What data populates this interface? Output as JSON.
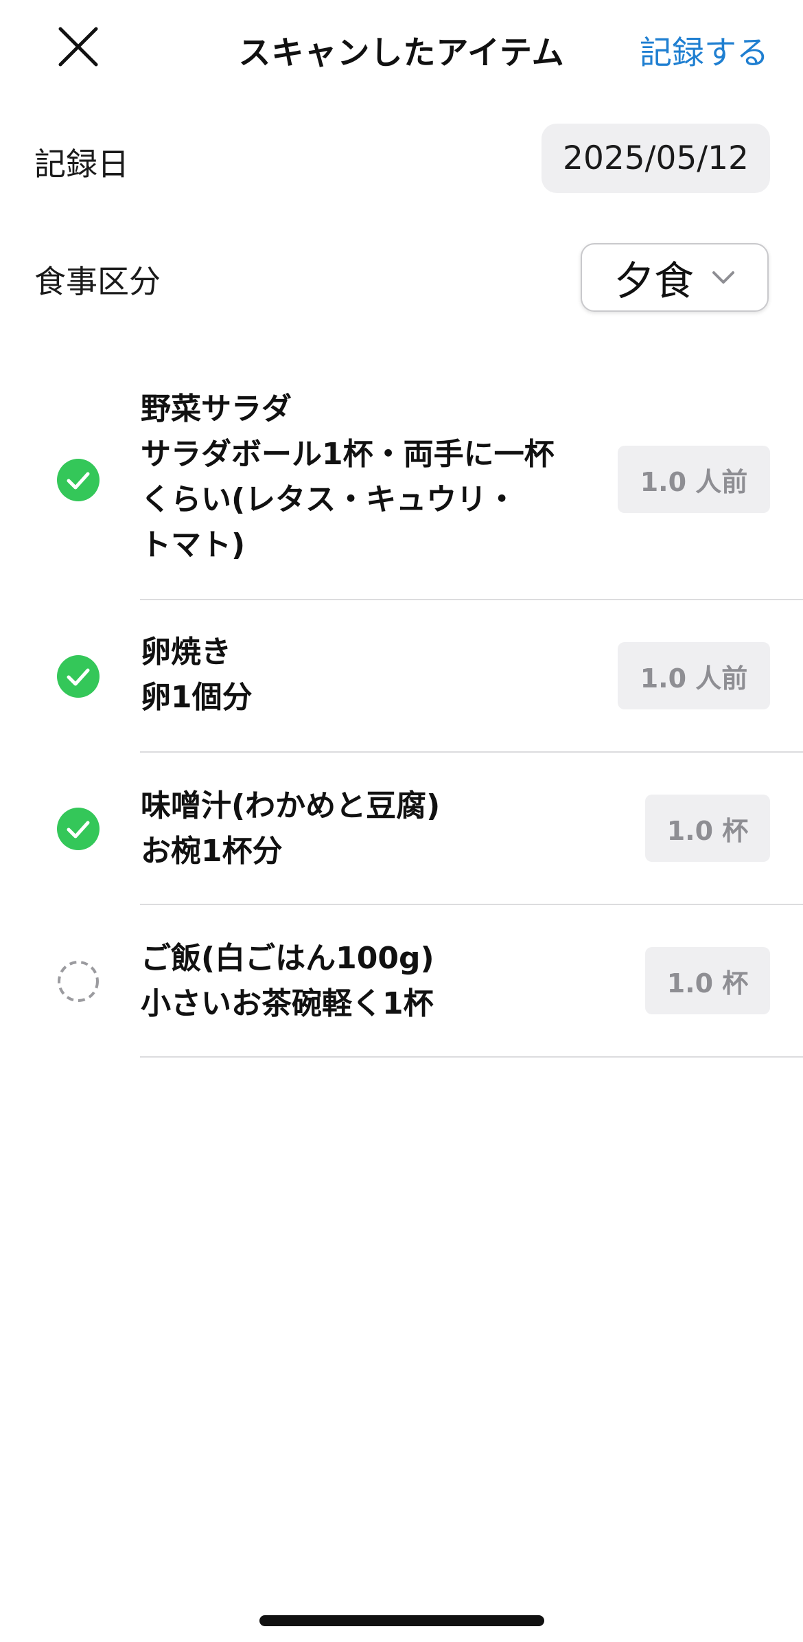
{
  "header": {
    "title": "スキャンしたアイテム",
    "record_label": "記録する",
    "close_icon": "close-icon"
  },
  "form": {
    "date_label": "記録日",
    "date_value": "2025/05/12",
    "meal_label": "食事区分",
    "meal_value": "夕食"
  },
  "items": [
    {
      "lines": [
        "野菜サラダ",
        "サラダボール1杯・両手に一杯",
        "くらい(レタス・キュウリ・",
        "トマト)"
      ],
      "quantity": "1.0 人前",
      "checked": true
    },
    {
      "lines": [
        "卵焼き",
        "卵1個分"
      ],
      "quantity": "1.0 人前",
      "checked": true
    },
    {
      "lines": [
        "味噌汁(わかめと豆腐)",
        "お椀1杯分"
      ],
      "quantity": "1.0 杯",
      "checked": true
    },
    {
      "lines": [
        "ご飯(白ごはん100g)",
        "小さいお茶碗軽く1杯"
      ],
      "quantity": "1.0 杯",
      "checked": false
    }
  ],
  "colors": {
    "accent": "#1f7fd1",
    "check_green": "#34c759",
    "unchecked_gray": "#9b9b9f",
    "pill_bg": "#efeff1"
  }
}
